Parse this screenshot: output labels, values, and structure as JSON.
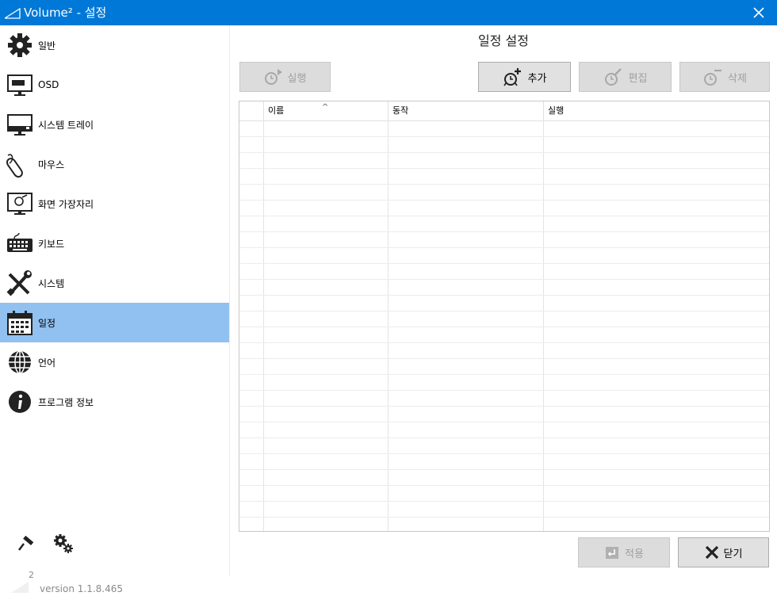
{
  "window": {
    "title": "Volume² - 설정"
  },
  "sidebar": {
    "items": [
      {
        "label": "일반",
        "icon": "gear-icon"
      },
      {
        "label": "OSD",
        "icon": "monitor-icon"
      },
      {
        "label": "시스템 트레이",
        "icon": "monitor-tray-icon"
      },
      {
        "label": "마우스",
        "icon": "mouse-icon"
      },
      {
        "label": "화면 가장자리",
        "icon": "screen-edge-icon"
      },
      {
        "label": "키보드",
        "icon": "keyboard-icon"
      },
      {
        "label": "시스템",
        "icon": "tools-icon"
      },
      {
        "label": "일정",
        "icon": "calendar-icon"
      },
      {
        "label": "언어",
        "icon": "globe-icon"
      },
      {
        "label": "프로그램 정보",
        "icon": "info-icon"
      }
    ],
    "active_index": 7,
    "version": "version 1.1.8.465",
    "logo_text": "2"
  },
  "main": {
    "title": "일정 설정",
    "toolbar": {
      "run": "실행",
      "add": "추가",
      "edit": "편집",
      "delete": "삭제"
    },
    "columns": [
      "이름",
      "동작",
      "실행"
    ]
  },
  "footer": {
    "apply": "적용",
    "close": "닫기"
  },
  "colors": {
    "titlebar": "#0078d7",
    "active_nav": "#91c1f0"
  }
}
